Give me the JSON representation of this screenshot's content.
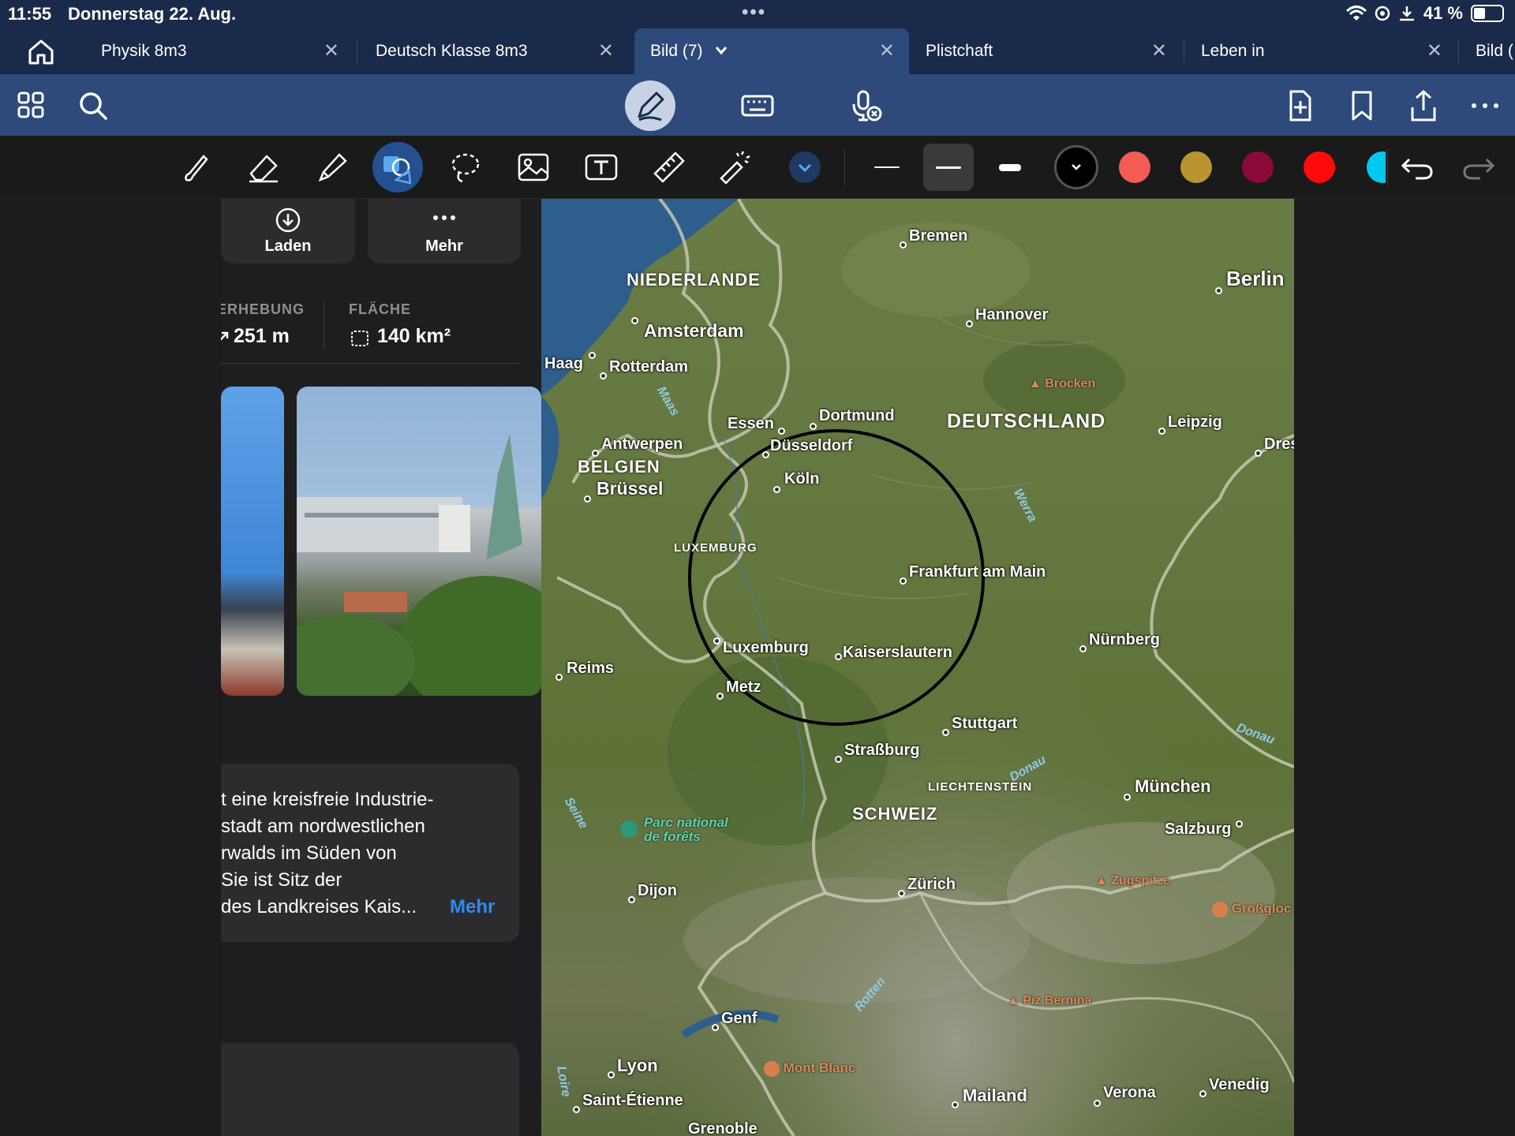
{
  "status": {
    "time": "11:55",
    "date": "Donnerstag 22. Aug.",
    "battery": "41 %",
    "battery_level": 0.41
  },
  "tabs": [
    {
      "label": "Physik 8m3"
    },
    {
      "label": "Deutsch Klasse 8m3"
    },
    {
      "label": "Bild (7)"
    },
    {
      "label": "Plistchaft"
    },
    {
      "label": "Leben in"
    },
    {
      "label": "Bild ("
    }
  ],
  "panel": {
    "load_label": "Laden",
    "more_label": "Mehr",
    "elevation_label": "ERHEBUNG",
    "elevation_value": "251 m",
    "area_label": "FLÄCHE",
    "area_value": "140 km²",
    "description_lines": [
      "t eine kreisfreie Industrie-",
      "stadt am nordwestlichen",
      "rwalds im Süden von",
      " Sie ist Sitz der",
      "des Landkreises Kais..."
    ],
    "description_more": "Mehr"
  },
  "map": {
    "cities": [
      {
        "name": "Bremen"
      },
      {
        "name": "Berlin"
      },
      {
        "name": "Hannover"
      },
      {
        "name": "Amsterdam"
      },
      {
        "name": "Haag"
      },
      {
        "name": "Rotterdam"
      },
      {
        "name": "Essen"
      },
      {
        "name": "Dortmund"
      },
      {
        "name": "Leipzig"
      },
      {
        "name": "Dres"
      },
      {
        "name": "Antwerpen"
      },
      {
        "name": "Düsseldorf"
      },
      {
        "name": "Brüssel"
      },
      {
        "name": "Köln"
      },
      {
        "name": "Frankfurt am Main"
      },
      {
        "name": "Luxemburg"
      },
      {
        "name": "Kaiserslautern"
      },
      {
        "name": "Nürnberg"
      },
      {
        "name": "Reims"
      },
      {
        "name": "Metz"
      },
      {
        "name": "Stuttgart"
      },
      {
        "name": "Straßburg"
      },
      {
        "name": "München"
      },
      {
        "name": "Salzburg"
      },
      {
        "name": "Dijon"
      },
      {
        "name": "Zürich"
      },
      {
        "name": "Genf"
      },
      {
        "name": "Lyon"
      },
      {
        "name": "Saint-Étienne"
      },
      {
        "name": "Mailand"
      },
      {
        "name": "Verona"
      },
      {
        "name": "Venedig"
      },
      {
        "name": "Grenoble"
      }
    ],
    "countries": [
      {
        "name": "NIEDERLANDE"
      },
      {
        "name": "DEUTSCHLAND"
      },
      {
        "name": "BELGIEN"
      },
      {
        "name": "LUXEMBURG"
      },
      {
        "name": "LIECHTENSTEIN"
      },
      {
        "name": "SCHWEIZ"
      }
    ],
    "peaks": [
      {
        "name": "Brocken"
      },
      {
        "name": "Zugspitze"
      },
      {
        "name": "Großgloc"
      },
      {
        "name": "Piz Bernina"
      },
      {
        "name": "Mont Blanc"
      }
    ],
    "rivers": [
      {
        "name": "Maas"
      },
      {
        "name": "Werra"
      },
      {
        "name": "Donau"
      },
      {
        "name": "Donau"
      },
      {
        "name": "Seine"
      },
      {
        "name": "Rotten"
      },
      {
        "name": "Loire"
      }
    ],
    "park_line1": "Parc national",
    "park_line2": "de forêts"
  },
  "colors": {
    "accent": "#2f8af5",
    "tab_bg": "#1a2a4a",
    "toolbar_bg": "#2d4a7a",
    "swatch_black": "#000000",
    "swatch_salmon": "#f25c54",
    "swatch_gold": "#b8952e",
    "swatch_maroon": "#8b0a3a",
    "swatch_red": "#ff0a0a",
    "swatch_cyan": "#00c8f0"
  },
  "icons": {
    "home": "house-icon",
    "grid": "grid-icon",
    "search": "search-icon",
    "pen": "pen-icon",
    "keyboard": "keyboard-icon",
    "mic": "mic-off-icon",
    "add_page": "add-page-icon",
    "bookmark": "bookmark-icon",
    "share": "share-icon",
    "more": "ellipsis-icon"
  }
}
